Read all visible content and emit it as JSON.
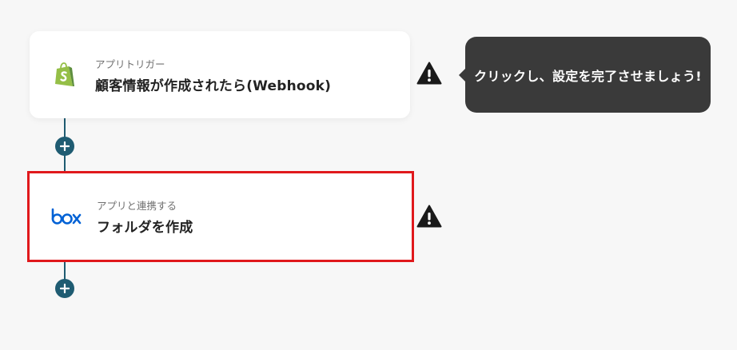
{
  "flow": {
    "trigger": {
      "kicker": "アプリトリガー",
      "title": "顧客情報が作成されたら(Webhook)",
      "app_icon": "shopify-icon",
      "brand_color": "#95bf47"
    },
    "action": {
      "kicker": "アプリと連携する",
      "title": "フォルダを作成",
      "app_icon": "box-icon",
      "brand_color": "#0061d5",
      "highlight_color": "#e0191c"
    },
    "connector_color": "#1f5c72",
    "add_icon": "plus-icon",
    "warning_icon": "warning-icon"
  },
  "tooltip": {
    "text": "クリックし、設定を完了させましょう!"
  }
}
